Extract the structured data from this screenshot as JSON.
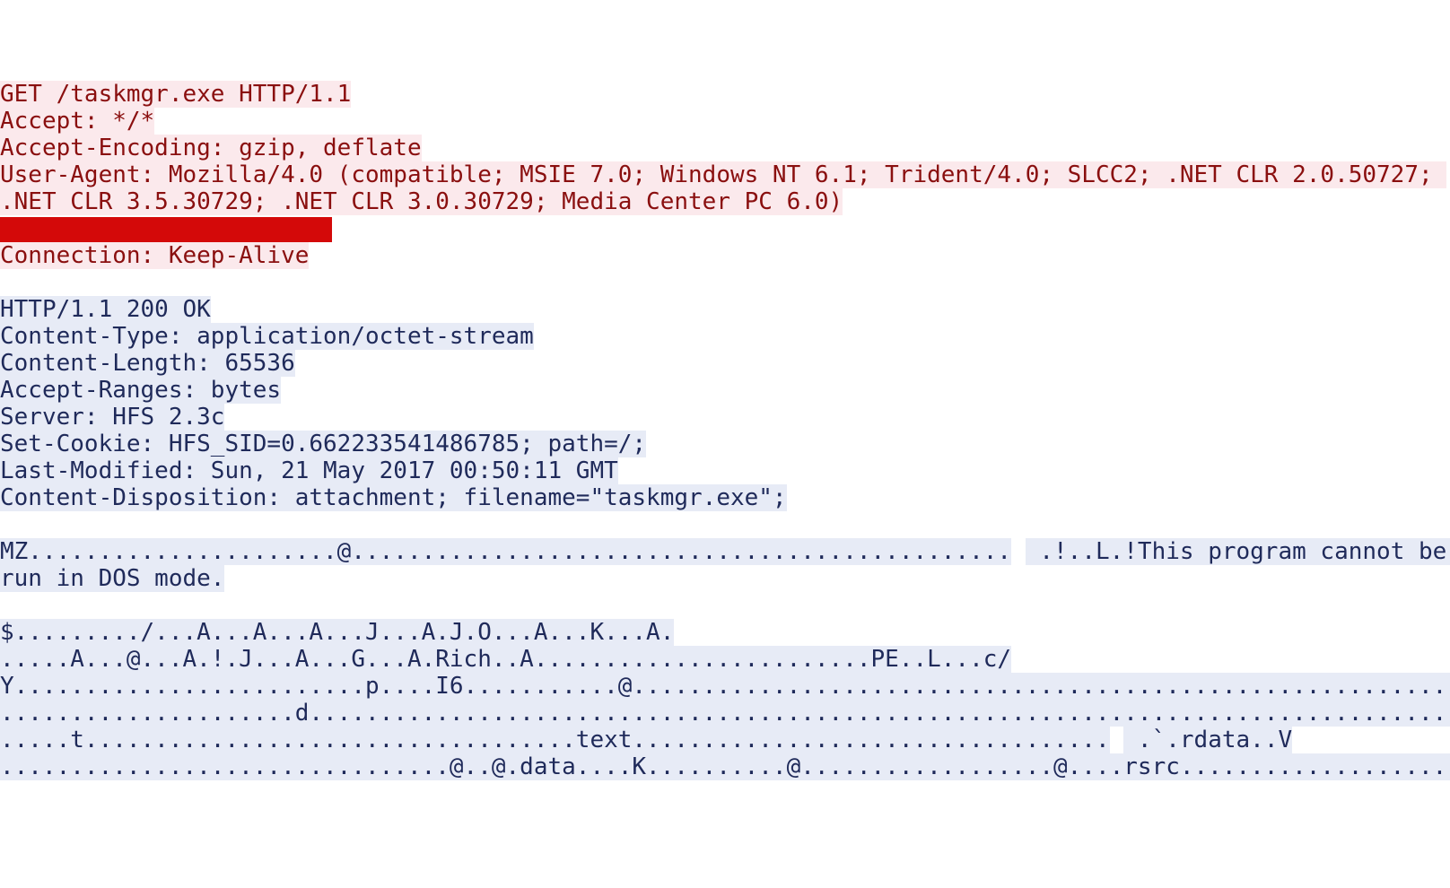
{
  "request": {
    "lines": [
      "GET /taskmgr.exe HTTP/1.1",
      "Accept: */*",
      "Accept-Encoding: gzip, deflate",
      "User-Agent: Mozilla/4.0 (compatible; MSIE 7.0; Windows NT 6.1; Trident/4.0; SLCC2; .NET CLR 2.0.50727; ",
      ".NET CLR 3.5.30729; .NET CLR 3.0.30729; Media Center PC 6.0)",
      "",
      "Connection: Keep-Alive"
    ],
    "redacted_index": 5
  },
  "blank_between": "",
  "response": {
    "headers": [
      "HTTP/1.1 200 OK",
      "Content-Type: application/octet-stream",
      "Content-Length: 65536",
      "Accept-Ranges: bytes",
      "Server: HFS 2.3c",
      "Set-Cookie: HFS_SID=0.662233541486785; path=/;",
      "Last-Modified: Sun, 21 May 2017 00:50:11 GMT",
      "Content-Disposition: attachment; filename=\"taskmgr.exe\";"
    ],
    "body_lines": [
      {
        "a": "MZ......................@...............................................",
        "b": " .!..L.!This program cannot be "
      },
      {
        "a": "run in DOS mode.",
        "b": ""
      },
      {
        "a": "",
        "b": ""
      },
      {
        "a": "$........./...A...A...A...J...A.J.O...A...K...A.",
        "b": ""
      },
      {
        "a": ".....A...@...A.!.J...A...G...A.Rich..A........................PE..L...c/",
        "b": ""
      },
      {
        "a": "Y.........................p....I6...........@..................................................................",
        "b": ""
      },
      {
        "a": ".....................d..........................................................................................",
        "b": ""
      },
      {
        "a": ".....t...................................text..................................",
        "b": " .`.rdata..V"
      },
      {
        "a": "................................@..@.data....K..........@..................@....rsrc...........................",
        "b": ""
      }
    ]
  }
}
